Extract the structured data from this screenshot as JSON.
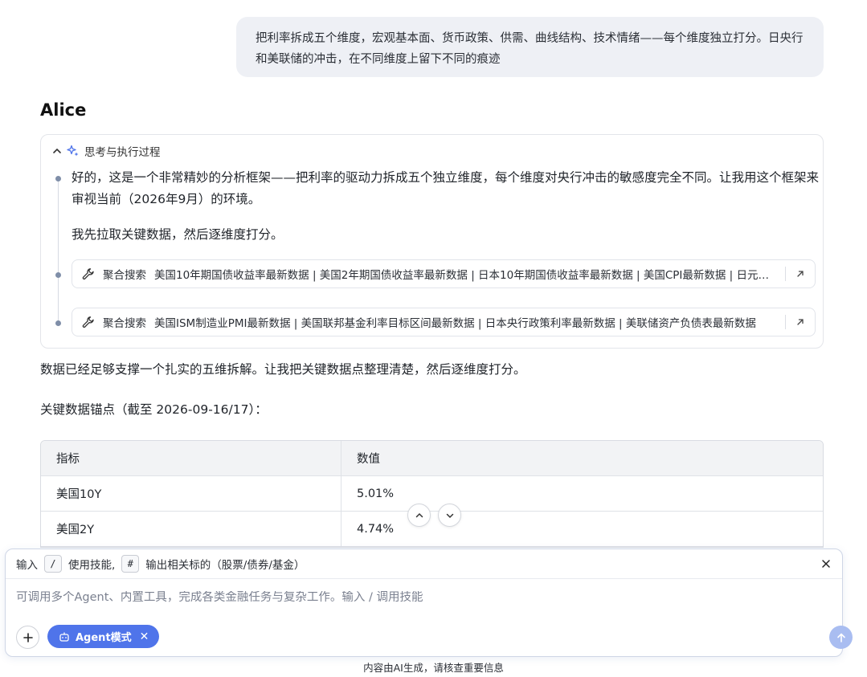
{
  "user_message": "把利率拆成五个维度，宏观基本面、货币政策、供需、曲线结构、技术情绪——每个维度独立打分。日央行和美联储的冲击，在不同维度上留下不同的痕迹",
  "agent": {
    "name": "Alice",
    "thinking_title": "思考与执行过程",
    "thinking_text1": "好的，这是一个非常精妙的分析框架——把利率的驱动力拆成五个独立维度，每个维度对央行冲击的敏感度完全不同。让我用这个框架来审视当前（2026年9月）的环境。",
    "thinking_text2": "我先拉取关键数据，然后逐维度打分。",
    "tool_calls": [
      {
        "name": "聚合搜索",
        "query": "美国10年期国债收益率最新数据 | 美国2年期国债收益率最新数据 | 日本10年期国债收益率最新数据 | 美国CPI最新数据 | 日元兑美元汇率最新数据"
      },
      {
        "name": "聚合搜索",
        "query": "美国ISM制造业PMI最新数据 | 美国联邦基金利率目标区间最新数据 | 日本央行政策利率最新数据 | 美联储资产负债表最新数据"
      }
    ]
  },
  "content": {
    "para1": "数据已经足够支撑一个扎实的五维拆解。让我把关键数据点整理清楚，然后逐维度打分。",
    "para2": "关键数据锚点（截至 2026-09-16/17）："
  },
  "table": {
    "headers": [
      "指标",
      "数值"
    ],
    "rows": [
      [
        "美国10Y",
        "5.01%"
      ],
      [
        "美国2Y",
        "4.74%"
      ]
    ]
  },
  "composer": {
    "hint_prefix": "输入",
    "hint_key1": "/",
    "hint_mid": "使用技能,",
    "hint_key2": "#",
    "hint_suffix": "输出相关标的（股票/债券/基金）",
    "placeholder": "可调用多个Agent、内置工具，完成各类金融任务与复杂工作。输入 / 调用技能",
    "mode_chip": "Agent模式"
  },
  "footer": "内容由AI生成，请核查重要信息",
  "colors": {
    "accent": "#4f74ea",
    "send_disabled": "#a9bdf1",
    "bubble_bg": "#eef0f5"
  }
}
